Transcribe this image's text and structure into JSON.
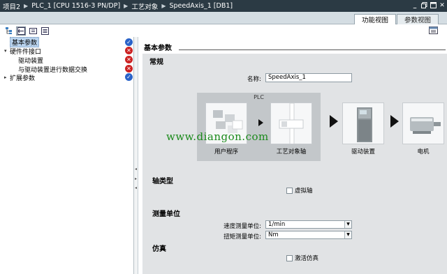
{
  "breadcrumb": [
    "项目2",
    "PLC_1 [CPU 1516-3 PN/DP]",
    "工艺对象",
    "SpeedAxis_1 [DB1]"
  ],
  "window_controls": [
    "minimize",
    "restore",
    "float",
    "close"
  ],
  "tabs": {
    "active": "功能视图",
    "inactive": "参数视图"
  },
  "nav": {
    "items": [
      {
        "label": "基本参数",
        "status": "ok",
        "level": 0,
        "expander": ""
      },
      {
        "label": "硬件件接口",
        "status": "err",
        "level": 0,
        "expander": "▾"
      },
      {
        "label": "驱动装置",
        "status": "err",
        "level": 1,
        "expander": ""
      },
      {
        "label": "与驱动装置进行数据交换",
        "status": "err",
        "level": 1,
        "expander": ""
      },
      {
        "label": "扩展参数",
        "status": "ok",
        "level": 0,
        "expander": "▸"
      }
    ]
  },
  "content": {
    "title": "基本参数",
    "general_heading": "常规",
    "name_label": "名称:",
    "name_value": "SpeedAxis_1",
    "diagram": {
      "plc_label": "PLC",
      "tiles": [
        "用户程序",
        "工艺对象轴",
        "驱动装置",
        "电机"
      ]
    },
    "axis_type_heading": "轴类型",
    "virtual_axis_label": "虚拟轴",
    "units_heading": "测量单位",
    "speed_unit_label": "速度测量单位:",
    "speed_unit_value": "1/min",
    "torque_unit_label": "扭矩测量单位:",
    "torque_unit_value": "Nm",
    "simulation_heading": "仿真",
    "activate_sim_label": "激活仿真"
  },
  "watermark": "www.diangon.com",
  "colors": {
    "titlebar": "#2b3a44",
    "ok": "#2a63c9",
    "error": "#cc2222",
    "section_bg": "#e1e3e5",
    "watermark": "#1a8a1a"
  }
}
